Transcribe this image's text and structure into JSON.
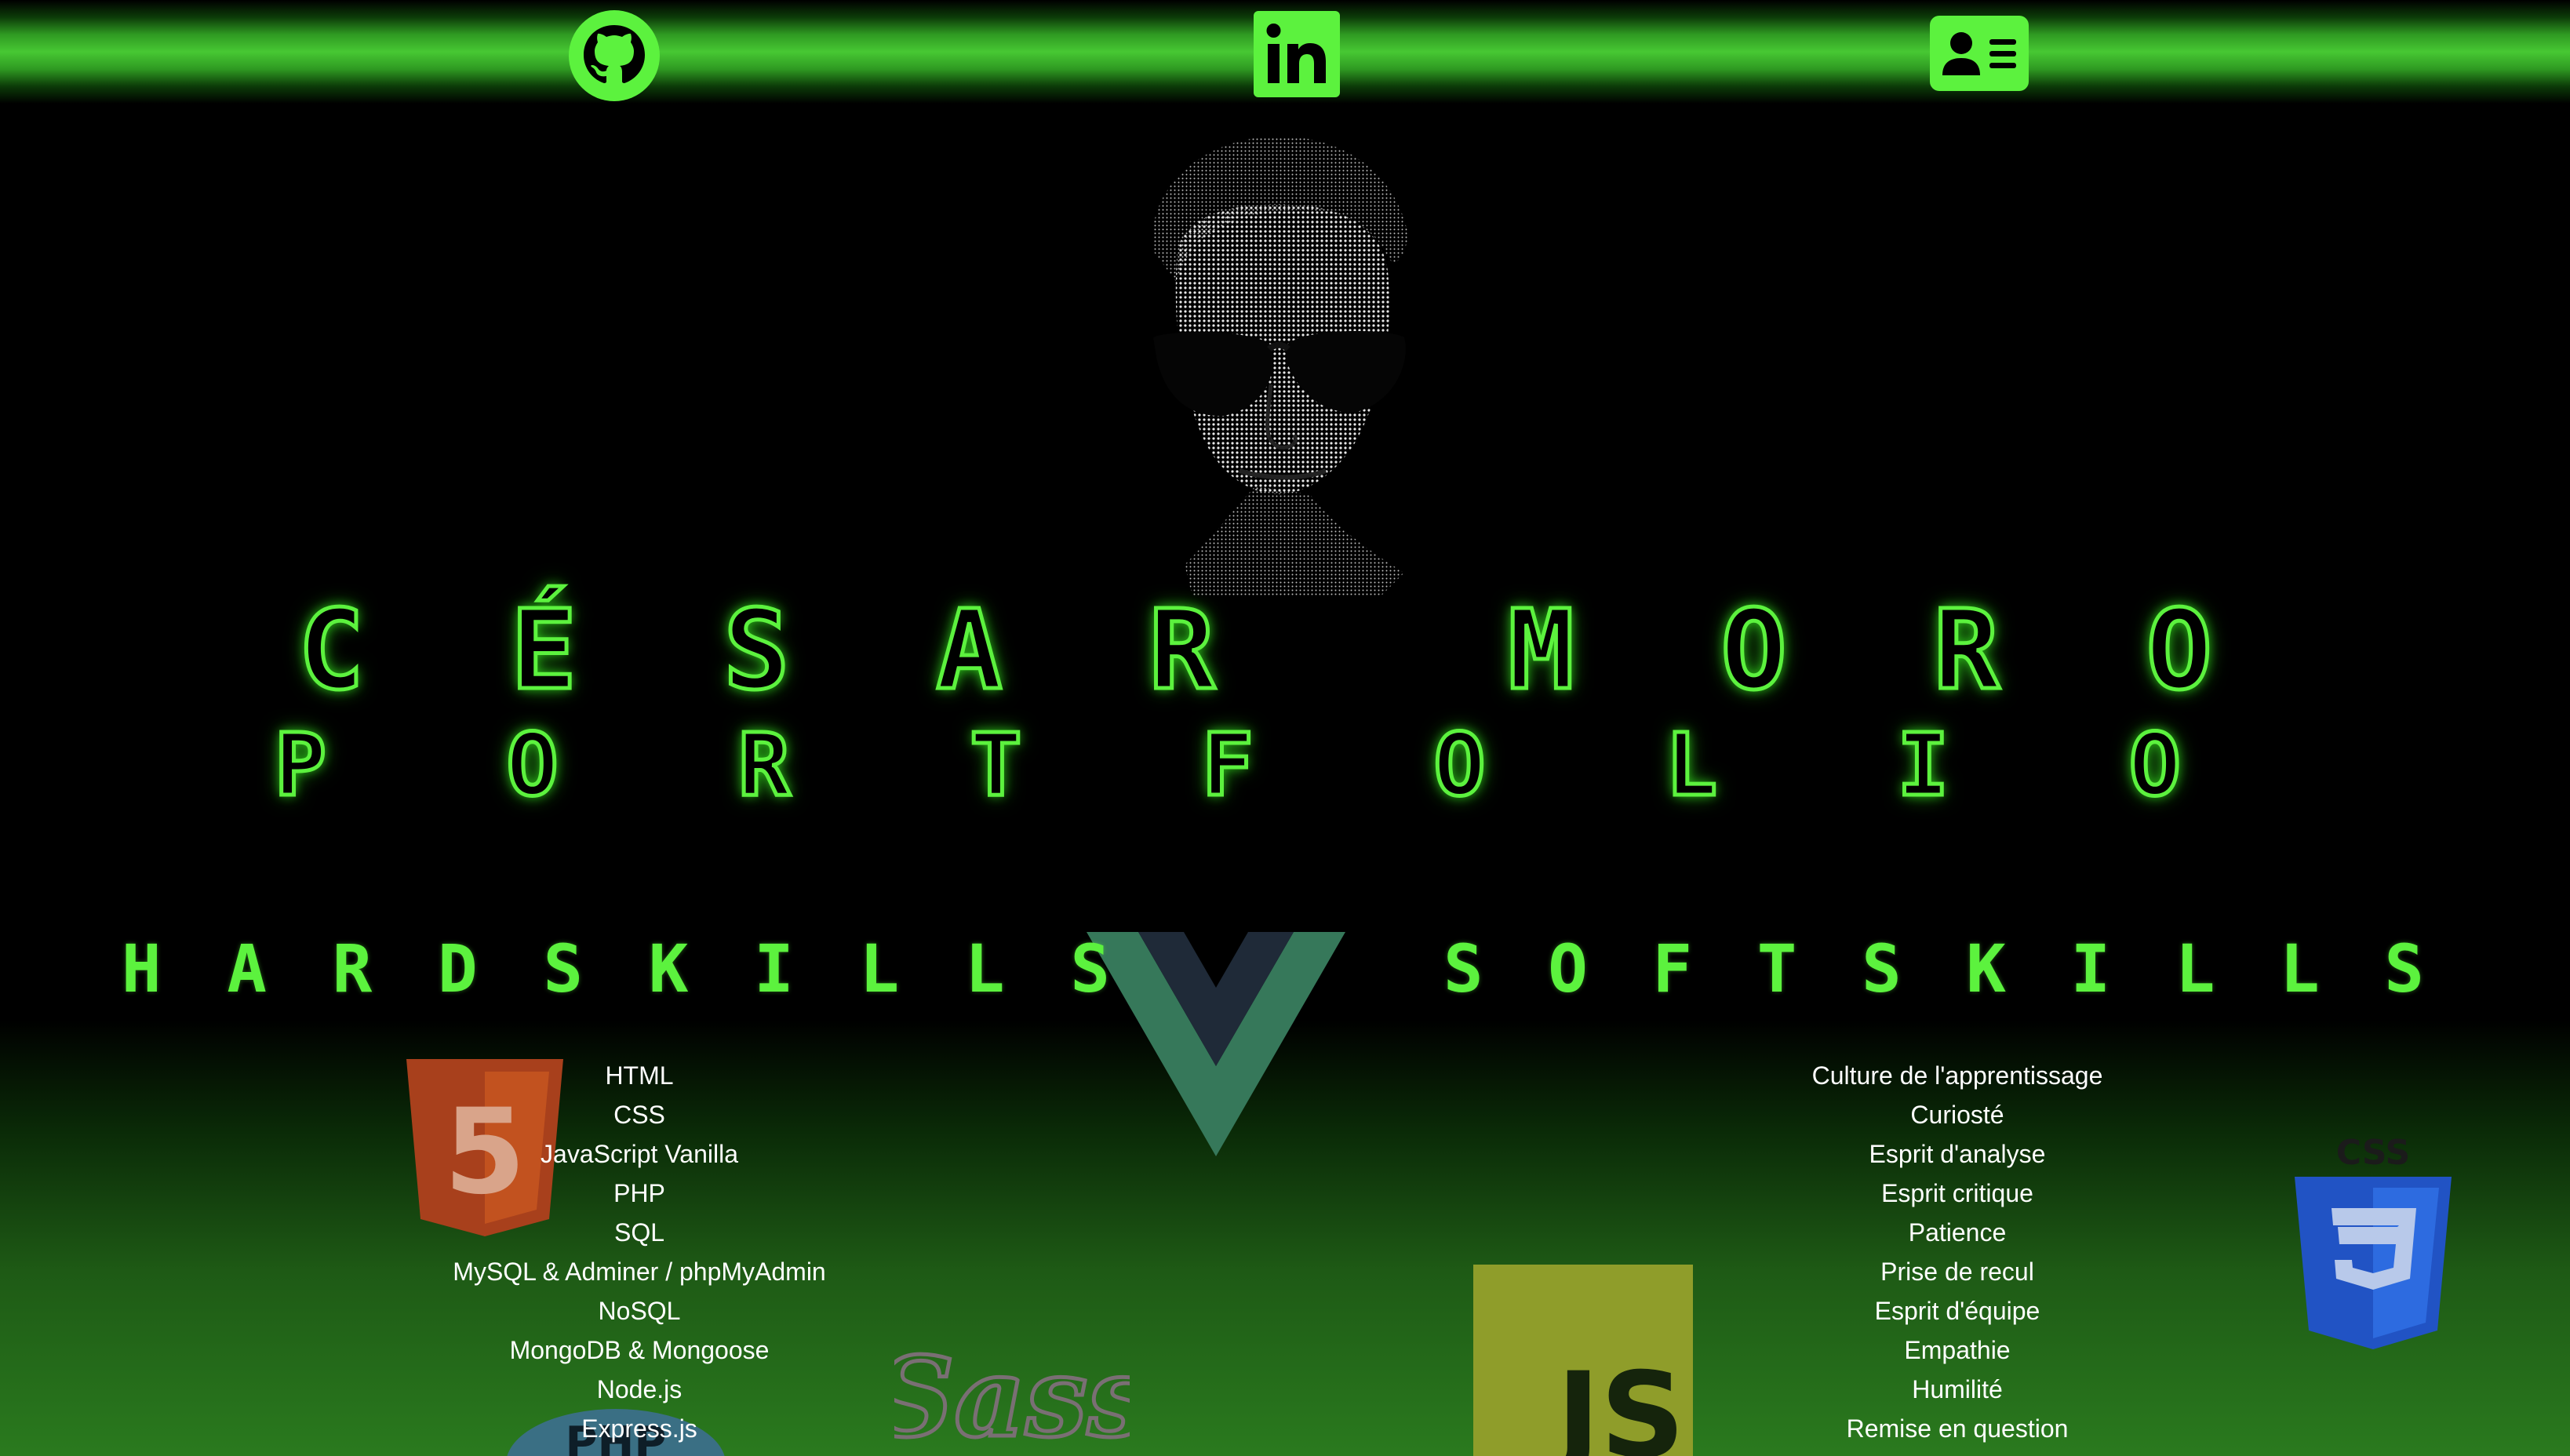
{
  "nav": {
    "items": [
      {
        "name": "github",
        "icon": "github-icon"
      },
      {
        "name": "linkedin",
        "icon": "linkedin-icon"
      },
      {
        "name": "contact",
        "icon": "contact-card-icon"
      }
    ]
  },
  "hero": {
    "portrait": "profile-portrait",
    "name_letters": [
      "C",
      "É",
      "S",
      "A",
      "R",
      "",
      "M",
      "O",
      "R",
      "O"
    ],
    "subtitle_letters": [
      "P",
      "O",
      "R",
      "T",
      "F",
      "O",
      "L",
      "I",
      "O"
    ]
  },
  "hardskills": {
    "heading_letters": [
      "H",
      "A",
      "R",
      "D",
      "S",
      "K",
      "I",
      "L",
      "L",
      "S"
    ],
    "items": [
      "HTML",
      "CSS",
      "JavaScript Vanilla",
      "PHP",
      "SQL",
      "MySQL & Adminer / phpMyAdmin",
      "NoSQL",
      "MongoDB & Mongoose",
      "Node.js",
      "Express.js"
    ]
  },
  "softskills": {
    "heading_letters": [
      "S",
      "O",
      "F",
      "T",
      "S",
      "K",
      "I",
      "L",
      "L",
      "S"
    ],
    "items": [
      "Culture de l'apprentissage",
      "Curiosté",
      "Esprit d'analyse",
      "Esprit critique",
      "Patience",
      "Prise de recul",
      "Esprit d'équipe",
      "Empathie",
      "Humilité",
      "Remise en question"
    ]
  },
  "logos": {
    "html5_label": "5",
    "css3_label": "CSS",
    "js_label": "JS",
    "sass_label": "Sass",
    "php_label": "PHP"
  },
  "colors": {
    "accent": "#5cf23e",
    "background": "#000000",
    "gradient_bottom": "#2a7a1e"
  }
}
